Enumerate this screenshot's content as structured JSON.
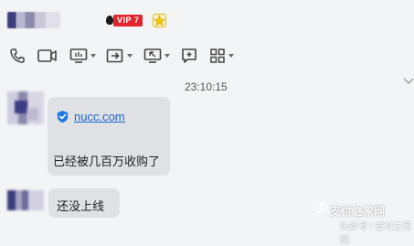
{
  "header": {
    "vip_label": "VIP 7"
  },
  "toolbar": {
    "items": [
      "phone",
      "video",
      "screen-share",
      "transfer-file",
      "remote-assist",
      "add-note",
      "apps"
    ]
  },
  "chat": {
    "timestamp": "23:10:15",
    "messages": [
      {
        "link": "nucc.com",
        "text": "已经被几百万收购了"
      },
      {
        "text": "还没上线"
      }
    ]
  },
  "watermark": {
    "line1": "支付之家网",
    "line2": "头条号 / 支付之家网"
  },
  "colors": {
    "link": "#1a66c9",
    "vip_badge": "#e0262c",
    "bubble": "#dfe1e5",
    "background": "#f3f4f6"
  }
}
